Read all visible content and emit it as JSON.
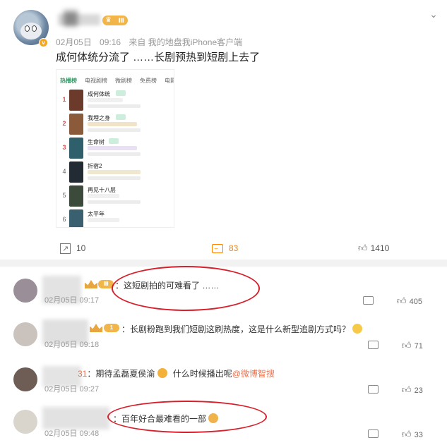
{
  "post": {
    "date": "02月05日",
    "time": "09:16",
    "source": "来自 我的地盘我iPhone客户端",
    "level_badge": "Ⅲ",
    "text": "成何体统分流了 ……长剧预热到短剧上去了",
    "screenshot": {
      "tabs": [
        "热播榜",
        "电视剧榜",
        "微剧榜",
        "免费榜",
        "电影"
      ],
      "items": [
        {
          "rank": "1",
          "title": "成何体统"
        },
        {
          "rank": "2",
          "title": "我埋之身"
        },
        {
          "rank": "3",
          "title": "生命树"
        },
        {
          "rank": "4",
          "title": "折宿2"
        },
        {
          "rank": "5",
          "title": "再见十八层"
        },
        {
          "rank": "6",
          "title": "太平年"
        }
      ]
    },
    "reposts": "10",
    "comments": "83",
    "likes": "1410"
  },
  "comments": [
    {
      "text": "：这短剧拍的可难看了 ……",
      "date": "02月05日",
      "time": "09:17",
      "likes": "405"
    },
    {
      "level": "1",
      "text": "：长剧粉跑到我们短剧这刷热度，这是什么新型追剧方式吗？",
      "date": "02月05日",
      "time": "09:18",
      "likes": "71"
    },
    {
      "name_tail": "31",
      "text_before": "：期待孟磊夏侯渝",
      "text_middle": " 什么时候播出呢",
      "mention": "@微博智搜",
      "date": "02月05日",
      "time": "09:27",
      "likes": "23"
    },
    {
      "text": "：百年好合最难看的一部",
      "date": "02月05日",
      "time": "09:48",
      "likes": "33"
    }
  ]
}
